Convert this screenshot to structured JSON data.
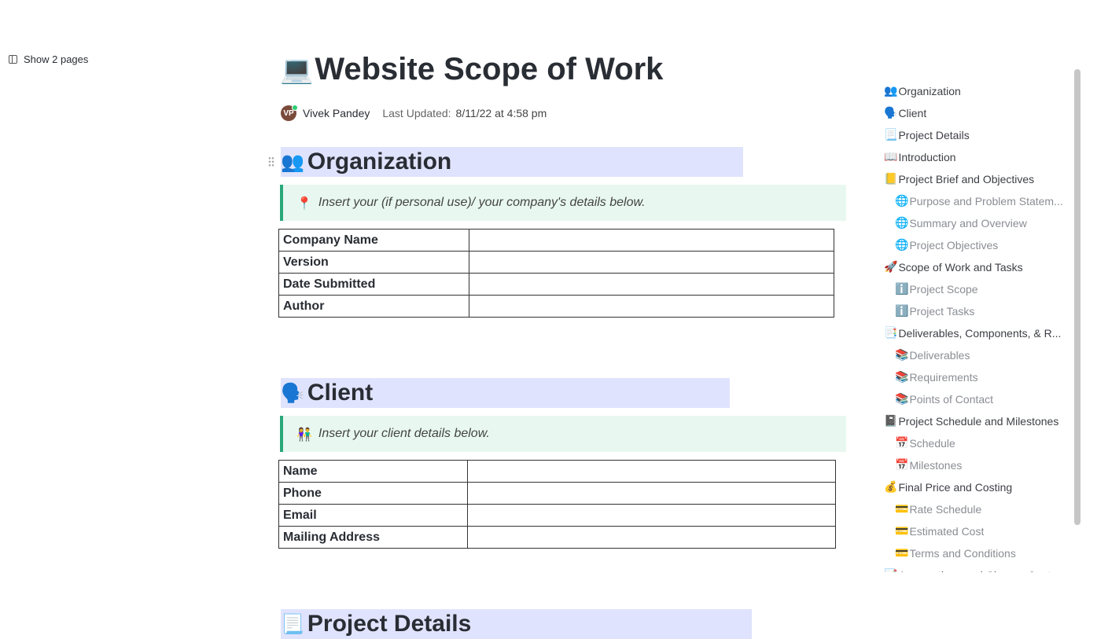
{
  "sidebar_toggle": {
    "label": "Show 2 pages"
  },
  "doc": {
    "title_emoji": "💻",
    "title": "Website Scope of Work",
    "author": "Vivek Pandey",
    "avatar_initials": "VP",
    "updated_label": "Last Updated:",
    "updated_value": "8/11/22 at 4:58 pm"
  },
  "sections": {
    "organization": {
      "emoji": "👥",
      "heading": "Organization",
      "callout_emoji": "📍",
      "callout": "Insert your (if personal use)/ your company's details below.",
      "rows": [
        "Company Name",
        "Version",
        "Date Submitted",
        "Author"
      ]
    },
    "client": {
      "emoji": "🗣️",
      "heading": "Client",
      "callout_emoji": "👫",
      "callout": "Insert your client details below.",
      "rows": [
        "Name",
        "Phone",
        "Email",
        "Mailing Address"
      ]
    },
    "project_details": {
      "emoji": "📃",
      "heading": "Project Details"
    }
  },
  "toc": [
    {
      "level": 1,
      "emoji": "👥",
      "label": "Organization"
    },
    {
      "level": 1,
      "emoji": "🗣️",
      "label": "Client"
    },
    {
      "level": 1,
      "emoji": "📃",
      "label": "Project Details"
    },
    {
      "level": 1,
      "emoji": "📖",
      "label": "Introduction"
    },
    {
      "level": 1,
      "emoji": "📒",
      "label": "Project Brief and Objectives"
    },
    {
      "level": 2,
      "emoji": "🌐",
      "label": "Purpose and Problem Statem..."
    },
    {
      "level": 2,
      "emoji": "🌐",
      "label": "Summary and Overview"
    },
    {
      "level": 2,
      "emoji": "🌐",
      "label": "Project Objectives"
    },
    {
      "level": 1,
      "emoji": "🚀",
      "label": "Scope of Work and Tasks"
    },
    {
      "level": 2,
      "emoji": "ℹ️",
      "label": "Project Scope"
    },
    {
      "level": 2,
      "emoji": "ℹ️",
      "label": "Project Tasks"
    },
    {
      "level": 1,
      "emoji": "📑",
      "label": "Deliverables, Components, & R..."
    },
    {
      "level": 2,
      "emoji": "📚",
      "label": "Deliverables"
    },
    {
      "level": 2,
      "emoji": "📚",
      "label": "Requirements"
    },
    {
      "level": 2,
      "emoji": "📚",
      "label": "Points of Contact"
    },
    {
      "level": 1,
      "emoji": "📓",
      "label": "Project Schedule and Milestones"
    },
    {
      "level": 2,
      "emoji": "📅",
      "label": "Schedule"
    },
    {
      "level": 2,
      "emoji": "📅",
      "label": "Milestones"
    },
    {
      "level": 1,
      "emoji": "💰",
      "label": "Final Price and Costing"
    },
    {
      "level": 2,
      "emoji": "💳",
      "label": "Rate Schedule"
    },
    {
      "level": 2,
      "emoji": "💳",
      "label": "Estimated Cost"
    },
    {
      "level": 2,
      "emoji": "💳",
      "label": "Terms and Conditions"
    },
    {
      "level": 1,
      "emoji": "📝",
      "label": "Assumptions and Change Cont..."
    }
  ],
  "colors": {
    "heading_band": "#e0e3fd",
    "callout_bg": "#e8f8f0",
    "callout_border": "#2aa87a",
    "text": "#292d34"
  }
}
